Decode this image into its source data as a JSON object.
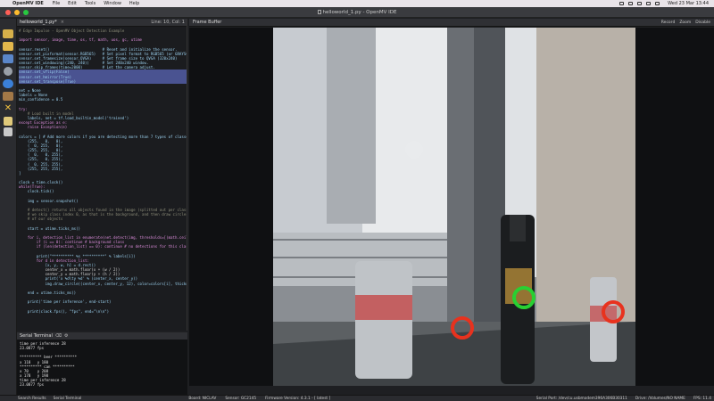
{
  "menubar": {
    "app_name": "OpenMV IDE",
    "menus": [
      "File",
      "Edit",
      "Tools",
      "Window",
      "Help"
    ],
    "clock": "Wed 23 Mar 13:44"
  },
  "window": {
    "title": "helloworld_1.py - OpenMV IDE"
  },
  "editor": {
    "tab_label": "helloworld_1.py*",
    "tab_close": "×",
    "cursor_pos": "Line: 10, Col: 1"
  },
  "code_lines": [
    "# Edge Impulse - OpenMV Object Detection Example",
    "",
    "import sensor, image, time, os, tf, math, uos, gc, utime",
    "",
    "sensor.reset()                        # Reset and initialize the sensor.",
    "sensor.set_pixformat(sensor.RGB565)   # Set pixel format to RGB565 (or GRAYSCALE)",
    "sensor.set_framesize(sensor.QVGA)     # Set frame size to QVGA (320x240)",
    "sensor.set_windowing((240, 240))      # Set 240x240 window.",
    "sensor.skip_frames(time=2000)         # Let the camera adjust.",
    "sensor.set_vflip(False)",
    "sensor.set_hmirror(True)",
    "sensor.set_transpose(True)",
    "",
    "net = None",
    "labels = None",
    "min_confidence = 0.5",
    "",
    "try:",
    "    # Load built in model",
    "    labels, net = tf.load_builtin_model('trained')",
    "except Exception as e:",
    "    raise Exception(e)",
    "",
    "colors = [ # Add more colors if you are detecting more than 7 types of classes at once.",
    "    (255,   0,   0),",
    "    (  0, 255,   0),",
    "    (255, 255,   0),",
    "    (  0,   0, 255),",
    "    (255,   0, 255),",
    "    (  0, 255, 255),",
    "    (255, 255, 255),",
    "]",
    "",
    "clock = time.clock()",
    "while(True):",
    "    clock.tick()",
    "",
    "    img = sensor.snapshot()",
    "",
    "    # detect() returns all objects found in the image (splitted out per class already)",
    "    # we skip class index 0, as that is the background, and then draw circles of the center",
    "    # of our objects",
    "",
    "    start = utime.ticks_ms()",
    "",
    "    for i, detection_list in enumerate(net.detect(img, thresholds=[(math.ceil(min_confidence * 255), 255)])):",
    "        if (i == 0): continue # background class",
    "        if (len(detection_list) == 0): continue # no detections for this class?",
    "",
    "        print(\"********** %s **********\" % labels[i])",
    "        for d in detection_list:",
    "            [x, y, w, h] = d.rect()",
    "            center_x = math.floor(x + (w / 2))",
    "            center_y = math.floor(y + (h / 2))",
    "            print('x %d\\ty %d' % (center_x, center_y))",
    "            img.draw_circle((center_x, center_y, 12), color=colors[i], thickness=2)",
    "",
    "    end = utime.ticks_ms()",
    "",
    "    print('time per inference', end-start)",
    "",
    "    print(clock.fps(), \"fps\", end=\"\\n\\n\")"
  ],
  "terminal": {
    "title": "Serial Terminal",
    "lines": [
      "time per inference 28",
      "23.0877 fps",
      "",
      "********** beer **********",
      "x 118   y 180",
      "********** can **********",
      "x 70    y 208",
      "x 178   y 198",
      "time per inference 28",
      "23.0877 fps"
    ]
  },
  "frame_buffer": {
    "title": "Frame Buffer",
    "options": [
      "Record",
      "Zoom",
      "Disable"
    ],
    "detections": [
      {
        "label": "beer",
        "color": "#28d032"
      },
      {
        "label": "can",
        "color": "#e8321e"
      },
      {
        "label": "can",
        "color": "#e8321e"
      }
    ]
  },
  "statusbar": {
    "tabs": [
      "Search Results",
      "Serial Terminal"
    ],
    "board": "Board: NICLAV",
    "sensor": "Sensor: GC2145",
    "firmware": "Firmware Version: 4.3.1 - [ latest ]",
    "serial_port": "Serial Port: /dev/cu.usbmodem396A306B30311",
    "drive": "Drive: /Volumes/NO NAME",
    "fps": "FPS: 11.4"
  }
}
